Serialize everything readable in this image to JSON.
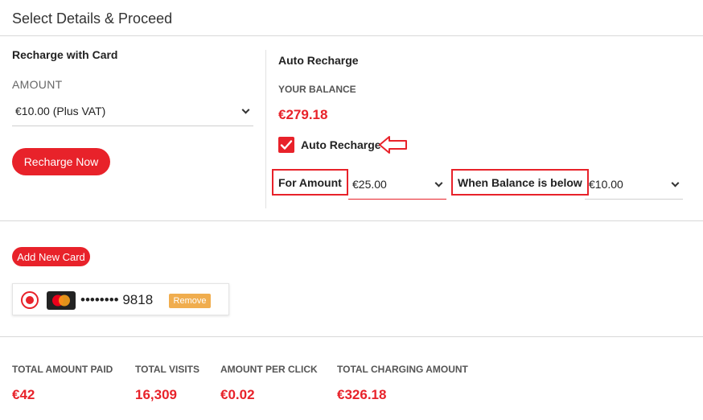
{
  "header": {
    "title": "Select Details & Proceed"
  },
  "recharge_card": {
    "title": "Recharge with Card",
    "amount_label": "AMOUNT",
    "amount_value": "€10.00 (Plus VAT)",
    "button_label": "Recharge Now"
  },
  "auto_recharge": {
    "title": "Auto Recharge",
    "balance_label": "YOUR BALANCE",
    "balance_value": "€279.18",
    "checkbox_label": "Auto Recharge",
    "checkbox_checked": true,
    "for_amount_label": "For Amount",
    "for_amount_value": "€25.00",
    "when_balance_label": "When Balance is below",
    "when_balance_value": "€10.00"
  },
  "cards": {
    "add_button_label": "Add New Card",
    "items": [
      {
        "masked_number": "•••••••• 9818",
        "remove_label": "Remove",
        "selected": true
      }
    ]
  },
  "stats": [
    {
      "label": "TOTAL AMOUNT PAID",
      "value": "€42"
    },
    {
      "label": "TOTAL VISITS",
      "value": "16,309"
    },
    {
      "label": "AMOUNT PER CLICK",
      "value": "€0.02"
    },
    {
      "label": "TOTAL CHARGING AMOUNT",
      "value": "€326.18"
    }
  ],
  "colors": {
    "accent": "#e8222a",
    "remove": "#f0ad4e"
  }
}
